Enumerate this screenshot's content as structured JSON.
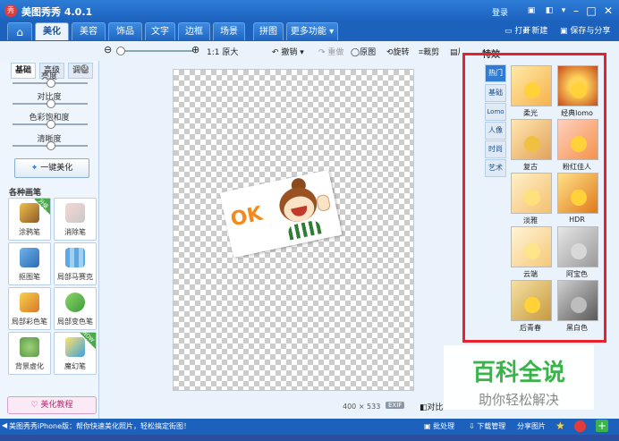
{
  "titlebar": {
    "title": "美图秀秀 4.0.1",
    "login": "登录",
    "icon_glyph": "秀"
  },
  "menu": {
    "tabs": [
      "美化",
      "美容",
      "饰品",
      "文字",
      "边框",
      "场景",
      "拼图",
      "更多功能"
    ],
    "active": "美化",
    "open": "打开",
    "new": "新建",
    "save_share": "保存与分享"
  },
  "toolbar": {
    "zoom_label": "1:1 原大",
    "undo": "撤销",
    "redo": "重做",
    "original": "原图",
    "rotate": "旋转",
    "crop": "裁剪",
    "resize": "尺寸"
  },
  "left_panel": {
    "subtabs": [
      "基础",
      "高级",
      "调色"
    ],
    "sliders": [
      "亮度",
      "对比度",
      "色彩饱和度",
      "清晰度"
    ],
    "one_key": "一键美化",
    "brush_title": "各种画笔",
    "brushes": [
      "涂鸦笔",
      "消除笔",
      "抠图笔",
      "局部马赛克",
      "局部彩色笔",
      "局部变色笔",
      "背景虚化",
      "魔幻笔"
    ],
    "badge_new": "升级",
    "badge_now": "NOW",
    "tutorial": "美化教程"
  },
  "canvas": {
    "sticker_text": "OK",
    "image_size": "400 × 533",
    "exif": "EXIF",
    "compare": "对比"
  },
  "right_panel": {
    "title": "特效",
    "vtabs": [
      "热门",
      "基础",
      "Lomo",
      "人像",
      "时尚",
      "艺术"
    ],
    "active_vtab": "热门",
    "effects": [
      "柔光",
      "经典lomo",
      "复古",
      "粉红佳人",
      "淡雅",
      "HDR",
      "云端",
      "阿宝色",
      "后青春",
      "黑白色"
    ]
  },
  "watermark": {
    "line1": "百科全说",
    "line2": "助你轻松解决"
  },
  "statusbar": {
    "message": "美图秀秀iPhone版：帮你快速美化照片，轻松搞定街图！",
    "batch": "批处理",
    "download": "下载管理",
    "share": "分享图片"
  },
  "colors": {
    "accent": "#1c62bd",
    "highlight_box": "#e8212e",
    "watermark": "#39b34a"
  }
}
